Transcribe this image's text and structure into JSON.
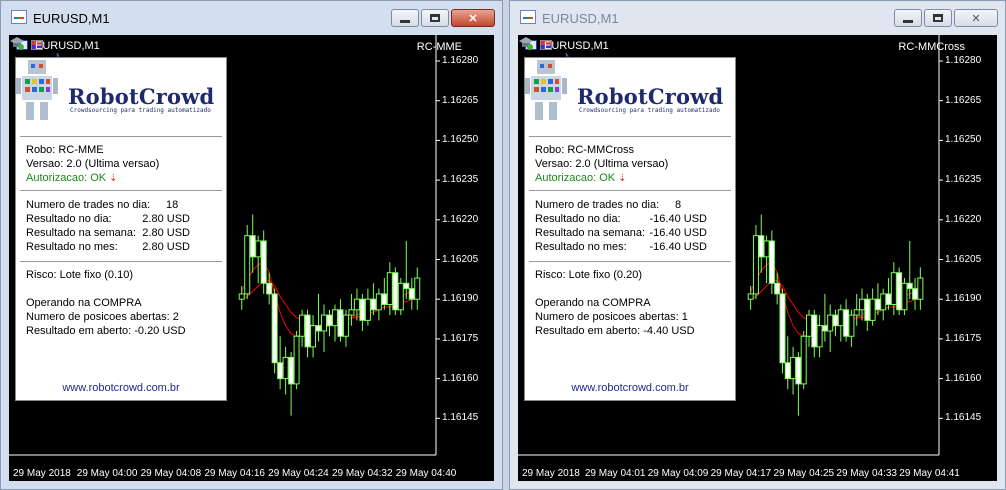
{
  "colors": {
    "bull": "#7cff59",
    "bear": "#ffffff",
    "ma": "#ff0000",
    "grid_text": "#ffffff"
  },
  "windows": [
    {
      "title": "EURUSD,M1",
      "symbol": "EURUSD,M1",
      "ea_name": "RC-MME",
      "price_labels": [
        "1.16280",
        "1.16265",
        "1.16250",
        "1.16235",
        "1.16220",
        "1.16205",
        "1.16190",
        "1.16175",
        "1.16160",
        "1.16145"
      ],
      "time_labels": [
        "29 May 2018",
        "29 May 04:00",
        "29 May 04:08",
        "29 May 04:16",
        "29 May 04:24",
        "29 May 04:32",
        "29 May 04:40"
      ],
      "panel": {
        "logo": "RobotCrowd",
        "tagline": "Crowdsourcing para trading automatizado",
        "robo": "Robo: RC-MME",
        "versao": "Versao: 2.0 (Ultima versao)",
        "autorizacao": "Autorizacao: OK",
        "trades_label": "Numero de trades no dia:",
        "trades_value": "18",
        "res_dia_label": "Resultado no dia:",
        "res_dia_value": "2.80 USD",
        "res_semana_label": "Resultado na semana:",
        "res_semana_value": "2.80 USD",
        "res_mes_label": "Resultado no mes:",
        "res_mes_value": "2.80 USD",
        "risco": "Risco: Lote fixo (0.10)",
        "operando": "Operando na COMPRA",
        "posicoes": "Numero de posicoes abertas: 2",
        "aberto": "Resultado em aberto: -0.20 USD",
        "link": "www.robotcrowd.com.br"
      }
    },
    {
      "title": "EURUSD,M1",
      "symbol": "EURUSD,M1",
      "ea_name": "RC-MMCross",
      "price_labels": [
        "1.16280",
        "1.16265",
        "1.16250",
        "1.16235",
        "1.16220",
        "1.16205",
        "1.16190",
        "1.16175",
        "1.16160",
        "1.16145"
      ],
      "time_labels": [
        "29 May 2018",
        "29 May 04:01",
        "29 May 04:09",
        "29 May 04:17",
        "29 May 04:25",
        "29 May 04:33",
        "29 May 04:41"
      ],
      "panel": {
        "logo": "RobotCrowd",
        "tagline": "Crowdsourcing para trading automatizado",
        "robo": "Robo: RC-MMCross",
        "versao": "Versao: 2.0 (Ultima versao)",
        "autorizacao": "Autorizacao: OK",
        "trades_label": "Numero de trades no dia:",
        "trades_value": "8",
        "res_dia_label": "Resultado no dia:",
        "res_dia_value": "-16.40 USD",
        "res_semana_label": "Resultado na semana:",
        "res_semana_value": "-16.40 USD",
        "res_mes_label": "Resultado no mes:",
        "res_mes_value": "-16.40 USD",
        "risco": "Risco: Lote fixo (0.20)",
        "operando": "Operando na COMPRA",
        "posicoes": "Numero de posicoes abertas: 1",
        "aberto": "Resultado em aberto: -4.40 USD",
        "link": "www.robotcrowd.com.br"
      }
    }
  ],
  "candles": [
    {
      "o": 1.1619,
      "h": 1.16195,
      "l": 1.16186,
      "c": 1.16192
    },
    {
      "o": 1.16192,
      "h": 1.16218,
      "l": 1.1619,
      "c": 1.16214
    },
    {
      "o": 1.16214,
      "h": 1.16222,
      "l": 1.162,
      "c": 1.16206
    },
    {
      "o": 1.16206,
      "h": 1.16214,
      "l": 1.16196,
      "c": 1.16212
    },
    {
      "o": 1.16212,
      "h": 1.16216,
      "l": 1.16192,
      "c": 1.16196
    },
    {
      "o": 1.16196,
      "h": 1.162,
      "l": 1.16188,
      "c": 1.16192
    },
    {
      "o": 1.16192,
      "h": 1.16194,
      "l": 1.16162,
      "c": 1.16166
    },
    {
      "o": 1.16166,
      "h": 1.16176,
      "l": 1.16156,
      "c": 1.1616
    },
    {
      "o": 1.1616,
      "h": 1.16172,
      "l": 1.16154,
      "c": 1.16168
    },
    {
      "o": 1.16168,
      "h": 1.1617,
      "l": 1.16146,
      "c": 1.16158
    },
    {
      "o": 1.16158,
      "h": 1.16178,
      "l": 1.16156,
      "c": 1.16176
    },
    {
      "o": 1.16176,
      "h": 1.16186,
      "l": 1.16172,
      "c": 1.16184
    },
    {
      "o": 1.16184,
      "h": 1.16186,
      "l": 1.16168,
      "c": 1.16172
    },
    {
      "o": 1.16172,
      "h": 1.16184,
      "l": 1.16168,
      "c": 1.1618
    },
    {
      "o": 1.1618,
      "h": 1.16192,
      "l": 1.16174,
      "c": 1.16178
    },
    {
      "o": 1.16178,
      "h": 1.16188,
      "l": 1.1617,
      "c": 1.16184
    },
    {
      "o": 1.16184,
      "h": 1.16186,
      "l": 1.16176,
      "c": 1.1618
    },
    {
      "o": 1.1618,
      "h": 1.16188,
      "l": 1.16174,
      "c": 1.16186
    },
    {
      "o": 1.16186,
      "h": 1.1619,
      "l": 1.16174,
      "c": 1.16176
    },
    {
      "o": 1.16176,
      "h": 1.16186,
      "l": 1.16172,
      "c": 1.16184
    },
    {
      "o": 1.16184,
      "h": 1.16192,
      "l": 1.1618,
      "c": 1.16186
    },
    {
      "o": 1.16186,
      "h": 1.16194,
      "l": 1.16182,
      "c": 1.1619
    },
    {
      "o": 1.1619,
      "h": 1.16192,
      "l": 1.16178,
      "c": 1.16182
    },
    {
      "o": 1.16182,
      "h": 1.16194,
      "l": 1.1618,
      "c": 1.1619
    },
    {
      "o": 1.1619,
      "h": 1.16196,
      "l": 1.16184,
      "c": 1.16186
    },
    {
      "o": 1.16186,
      "h": 1.16194,
      "l": 1.16182,
      "c": 1.16192
    },
    {
      "o": 1.16192,
      "h": 1.16198,
      "l": 1.16186,
      "c": 1.16188
    },
    {
      "o": 1.16188,
      "h": 1.16204,
      "l": 1.16184,
      "c": 1.162
    },
    {
      "o": 1.162,
      "h": 1.16202,
      "l": 1.16184,
      "c": 1.16186
    },
    {
      "o": 1.16186,
      "h": 1.16198,
      "l": 1.16184,
      "c": 1.16196
    },
    {
      "o": 1.16196,
      "h": 1.16212,
      "l": 1.1619,
      "c": 1.16194
    },
    {
      "o": 1.16194,
      "h": 1.16198,
      "l": 1.16186,
      "c": 1.1619
    },
    {
      "o": 1.1619,
      "h": 1.16202,
      "l": 1.16186,
      "c": 1.16198
    }
  ],
  "ma_fast": [
    1.16193,
    1.16197,
    1.16201,
    1.16203,
    1.16204,
    1.162,
    1.16192,
    1.16185,
    1.1618,
    1.16177,
    1.16176,
    1.16177,
    1.16177,
    1.16178,
    1.16178,
    1.16179,
    1.1618,
    1.16181,
    1.16181,
    1.16182,
    1.16183,
    1.16184,
    1.16185,
    1.16186,
    1.16187,
    1.16188,
    1.16188,
    1.1619,
    1.16191,
    1.16191,
    1.16192,
    1.16193,
    1.16193
  ],
  "ma_slow": [
    1.1619,
    1.16191,
    1.16193,
    1.16195,
    1.16197,
    1.16197,
    1.16195,
    1.16191,
    1.16188,
    1.16185,
    1.16183,
    1.16182,
    1.16181,
    1.1618,
    1.1618,
    1.16181,
    1.16181,
    1.16181,
    1.16182,
    1.16182,
    1.16183,
    1.16183,
    1.16184,
    1.16185,
    1.16185,
    1.16186,
    1.16187,
    1.16187,
    1.16188,
    1.16189,
    1.16189,
    1.1619,
    1.16191
  ]
}
